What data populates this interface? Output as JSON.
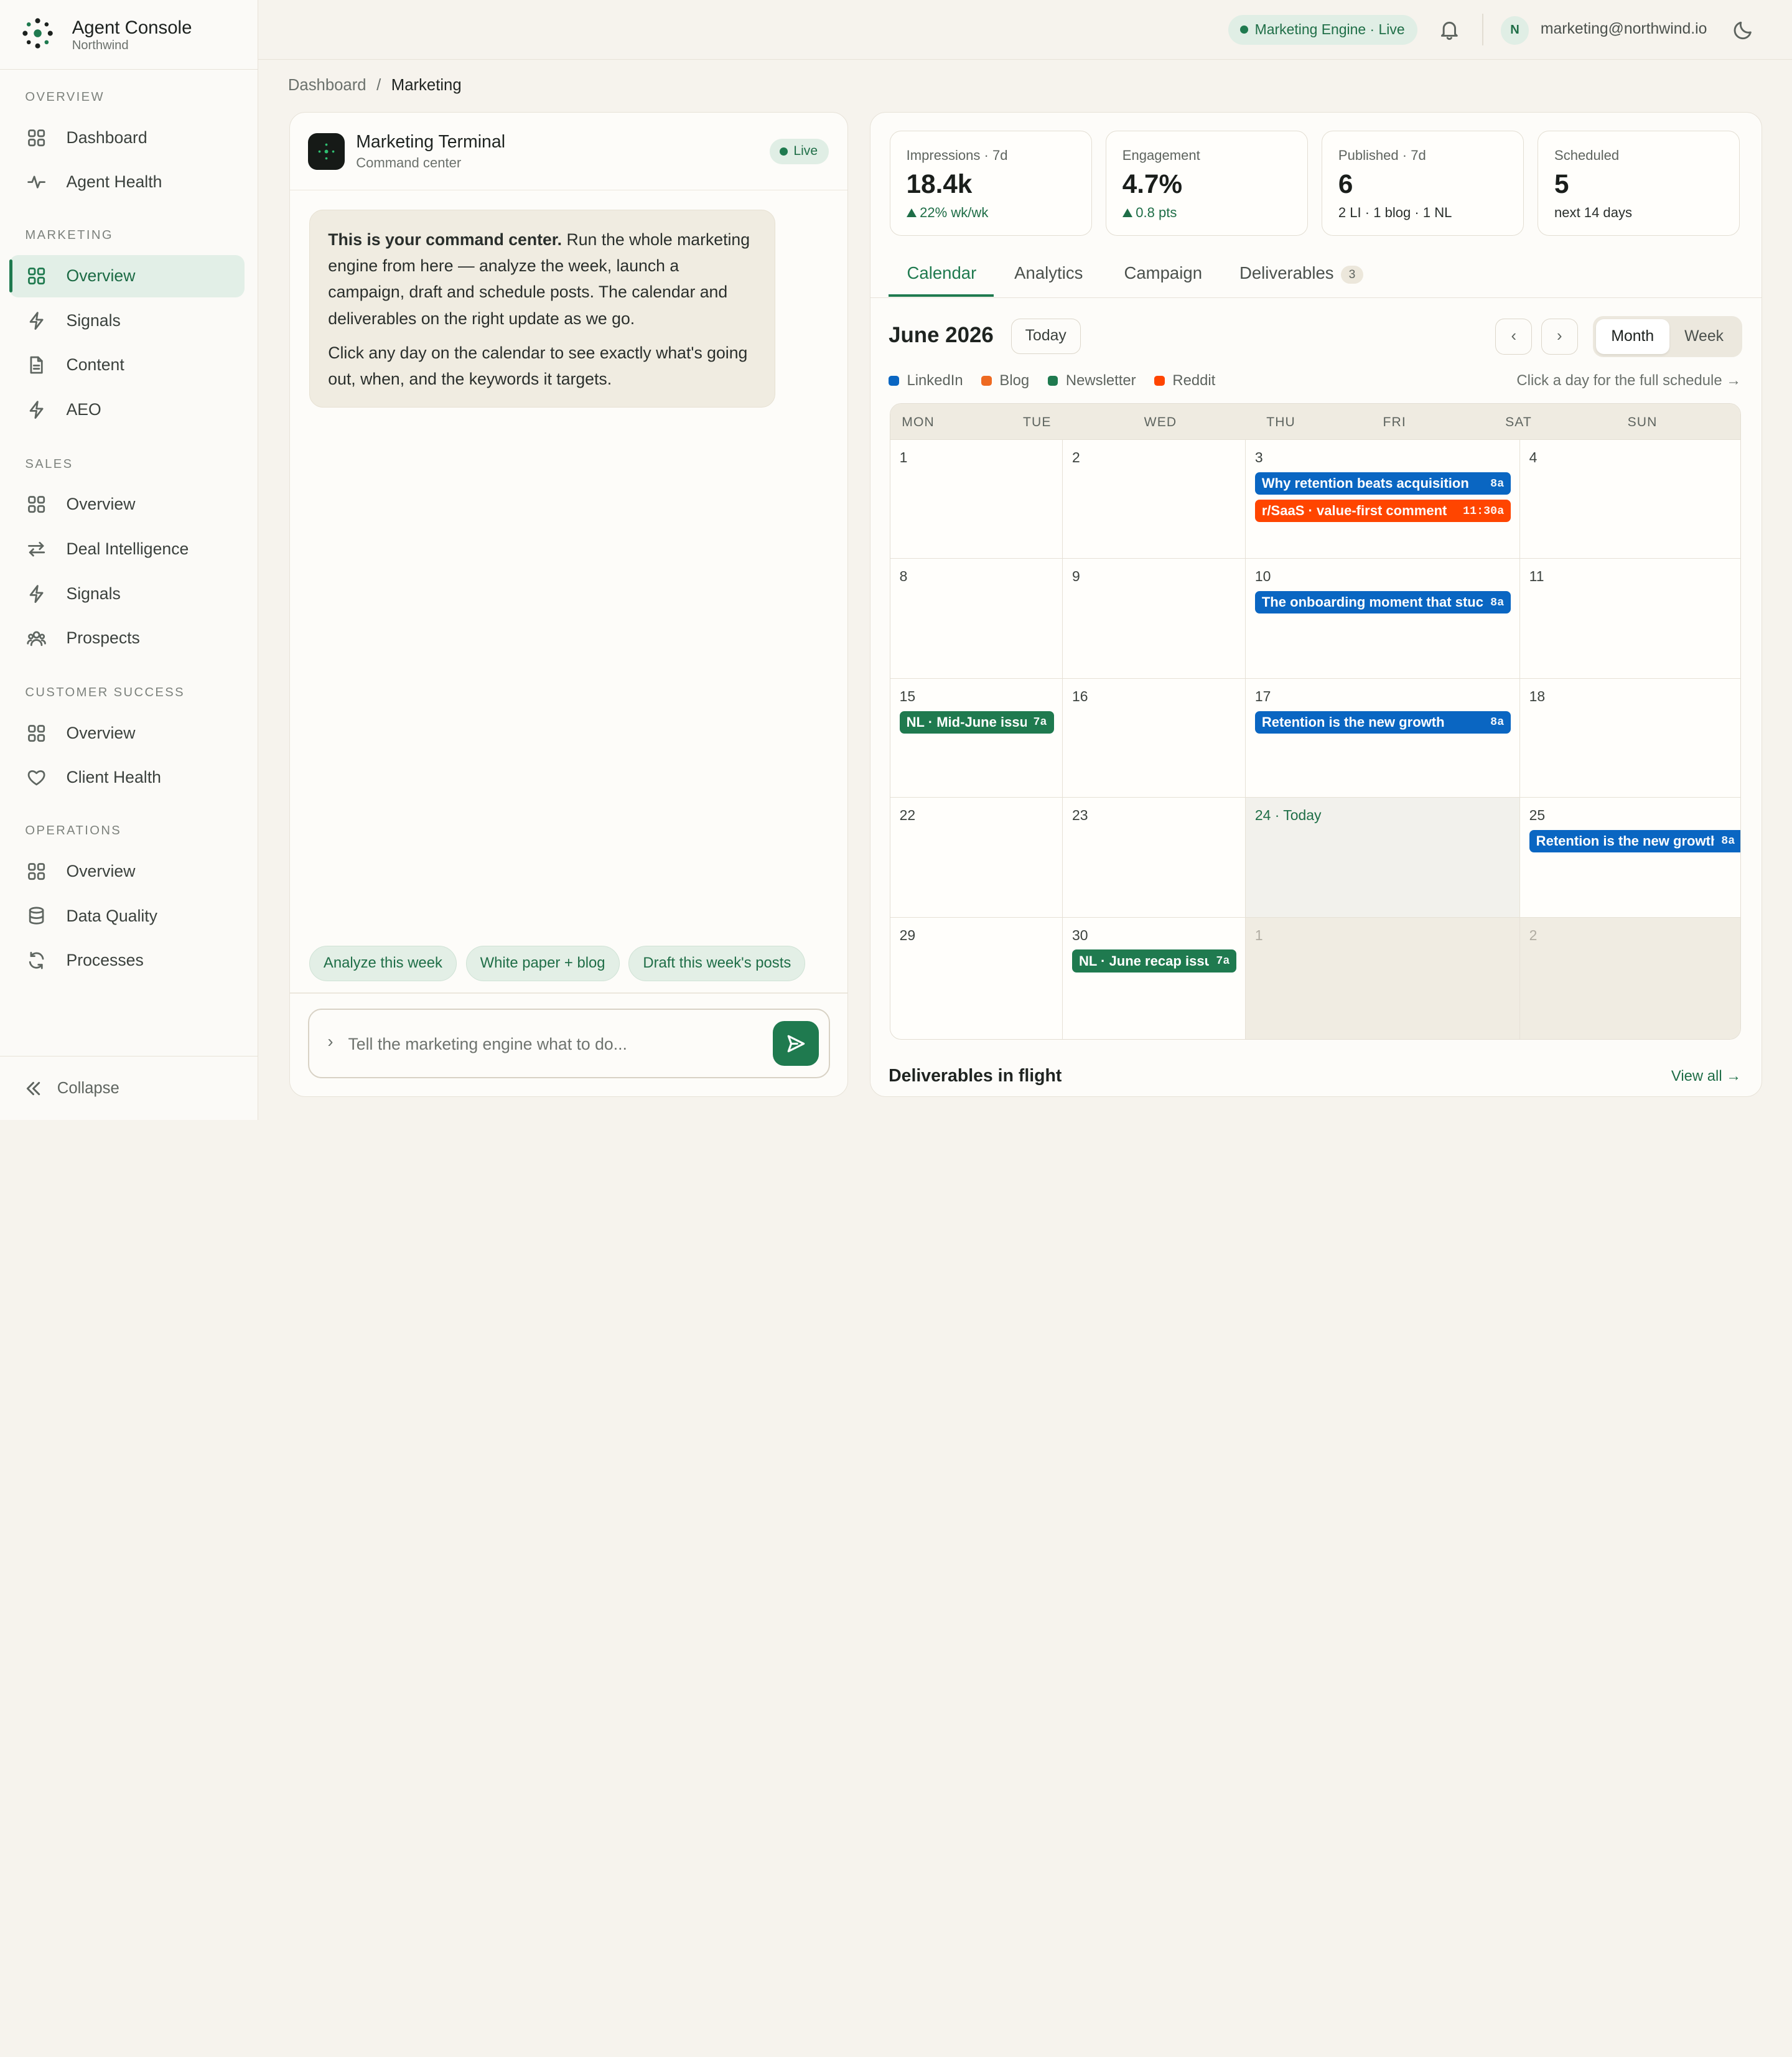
{
  "brand": {
    "title": "Agent Console",
    "subtitle": "Northwind"
  },
  "sidebar": {
    "sections": [
      {
        "label": "OVERVIEW",
        "items": [
          {
            "label": "Dashboard",
            "icon": "grid-icon"
          },
          {
            "label": "Agent Health",
            "icon": "pulse-icon"
          }
        ]
      },
      {
        "label": "MARKETING",
        "items": [
          {
            "label": "Overview",
            "icon": "grid-icon",
            "active": true
          },
          {
            "label": "Signals",
            "icon": "bolt-icon"
          },
          {
            "label": "Content",
            "icon": "document-icon"
          },
          {
            "label": "AEO",
            "icon": "bolt-icon"
          }
        ]
      },
      {
        "label": "SALES",
        "items": [
          {
            "label": "Overview",
            "icon": "grid-icon"
          },
          {
            "label": "Deal Intelligence",
            "icon": "arrows-swap-icon"
          },
          {
            "label": "Signals",
            "icon": "bolt-icon"
          },
          {
            "label": "Prospects",
            "icon": "users-icon"
          }
        ]
      },
      {
        "label": "CUSTOMER SUCCESS",
        "items": [
          {
            "label": "Overview",
            "icon": "grid-icon"
          },
          {
            "label": "Client Health",
            "icon": "heart-icon"
          }
        ]
      },
      {
        "label": "OPERATIONS",
        "items": [
          {
            "label": "Overview",
            "icon": "grid-icon"
          },
          {
            "label": "Data Quality",
            "icon": "database-icon"
          },
          {
            "label": "Processes",
            "icon": "refresh-icon"
          }
        ]
      }
    ],
    "collapse_label": "Collapse"
  },
  "topbar": {
    "engine_status": "Marketing Engine · Live",
    "avatar_initial": "N",
    "user_email": "marketing@northwind.io"
  },
  "breadcrumb": {
    "parent": "Dashboard",
    "separator": "/",
    "current": "Marketing"
  },
  "terminal": {
    "title": "Marketing Terminal",
    "subtitle": "Command center",
    "status": "Live",
    "message_bold": "This is your command center.",
    "message_rest": " Run the whole marketing engine from here — analyze the week, launch a campaign, draft and schedule posts. The calendar and deliverables on the right update as we go.",
    "message_2": "Click any day on the calendar to see exactly what's going out, when, and the keywords it targets.",
    "chips": [
      "Analyze this week",
      "White paper + blog",
      "Draft this week's posts"
    ],
    "input_placeholder": "Tell the marketing engine what to do...",
    "prompt_glyph": "›"
  },
  "stats": [
    {
      "label": "Impressions · 7d",
      "value": "18.4k",
      "sub": "22% wk/wk",
      "trend": "up"
    },
    {
      "label": "Engagement",
      "value": "4.7%",
      "sub": "0.8 pts",
      "trend": "up"
    },
    {
      "label": "Published · 7d",
      "value": "6",
      "sub": "2 LI · 1 blog · 1 NL",
      "trend": "none"
    },
    {
      "label": "Scheduled",
      "value": "5",
      "sub": "next 14 days",
      "trend": "none"
    }
  ],
  "tabs": [
    {
      "label": "Calendar",
      "active": true
    },
    {
      "label": "Analytics"
    },
    {
      "label": "Campaign"
    },
    {
      "label": "Deliverables",
      "count": "3"
    }
  ],
  "calendar": {
    "month_label": "June 2026",
    "today_button": "Today",
    "prev_glyph": "‹",
    "next_glyph": "›",
    "view_options": [
      "Month",
      "Week"
    ],
    "active_view": "Month",
    "legend": [
      {
        "label": "LinkedIn",
        "color": "#0a66c2"
      },
      {
        "label": "Blog",
        "color": "#ee6a22"
      },
      {
        "label": "Newsletter",
        "color": "#1f7a4f"
      },
      {
        "label": "Reddit",
        "color": "#ff4500"
      }
    ],
    "hint": "Click a day for the full schedule →",
    "weekdays": [
      "MON",
      "TUE",
      "WED",
      "THU",
      "FRI",
      "SAT",
      "SUN"
    ],
    "weeks": [
      [
        {
          "day": "1"
        },
        {
          "day": "2"
        },
        {
          "day": "3",
          "events": [
            {
              "title": "Why retention beats acquisition",
              "time": "8a",
              "channel": "LinkedIn"
            },
            {
              "title": "r/SaaS · value-first comment",
              "time": "11:30a",
              "channel": "Reddit"
            }
          ]
        },
        {
          "day": "4"
        }
      ],
      [
        {
          "day": "8"
        },
        {
          "day": "9"
        },
        {
          "day": "10",
          "events": [
            {
              "title": "The onboarding moment that stuck",
              "time": "8a",
              "channel": "LinkedIn"
            }
          ]
        },
        {
          "day": "11"
        }
      ],
      [
        {
          "day": "15",
          "events": [
            {
              "title": "NL · Mid-June issue",
              "time": "7a",
              "channel": "Newsletter"
            }
          ]
        },
        {
          "day": "16"
        },
        {
          "day": "17",
          "events": [
            {
              "title": "Retention is the new growth",
              "time": "8a",
              "channel": "LinkedIn"
            }
          ]
        },
        {
          "day": "18"
        }
      ],
      [
        {
          "day": "22"
        },
        {
          "day": "23"
        },
        {
          "day": "24 · Today",
          "today": true
        },
        {
          "day": "25",
          "events": [
            {
              "title": "Retention is the new growth.",
              "time": "8a",
              "channel": "LinkedIn"
            }
          ]
        }
      ],
      [
        {
          "day": "29"
        },
        {
          "day": "30",
          "events": [
            {
              "title": "NL · June recap issue",
              "time": "7a",
              "channel": "Newsletter"
            }
          ]
        },
        {
          "day": "1",
          "outside": true
        },
        {
          "day": "2",
          "outside": true
        }
      ]
    ]
  },
  "deliverables": {
    "title": "Deliverables in flight",
    "link": "View all →"
  }
}
